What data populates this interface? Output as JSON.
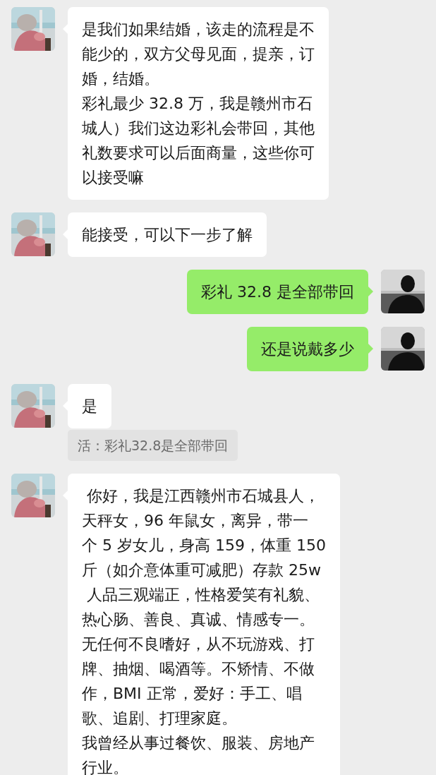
{
  "messages": [
    {
      "kind": "incoming",
      "lines": [
        "是我们如果结婚，该走的流程是不",
        "能少的，双方父母见面，提亲，订",
        "婚，结婚。",
        "彩礼最少 32.8 万，我是赣州市石",
        "城人）我们这边彩礼会带回，其他",
        "礼数要求可以后面商量，这些你可",
        "以接受嘛"
      ]
    },
    {
      "kind": "incoming",
      "lines": [
        "能接受，可以下一步了解"
      ]
    },
    {
      "kind": "outgoing",
      "lines": [
        "彩礼 32.8 是全部带回"
      ]
    },
    {
      "kind": "outgoing",
      "lines": [
        "还是说戴多少"
      ]
    },
    {
      "kind": "incoming",
      "lines": [
        "是"
      ],
      "quote": "活：彩礼32.8是全部带回"
    },
    {
      "kind": "incoming",
      "lines": [
        " 你好，我是江西赣州市石城县人，",
        "天秤女，96 年鼠女，离异，带一",
        "个 5 岁女儿，身高 159，体重 150",
        "斤（如介意体重可减肥）存款 25w",
        " 人品三观端正，性格爱笑有礼貌、",
        "热心肠、善良、真诚、情感专一。",
        "无任何不良嗜好，从不玩游戏、打",
        "牌、抽烟、喝酒等。不矫情、不做",
        "作，BMI 正常，爱好：手工、唱",
        "歌、追剧、打理家庭。",
        "我曾经从事过餐饮、服装、房地产",
        "行业。"
      ]
    }
  ]
}
